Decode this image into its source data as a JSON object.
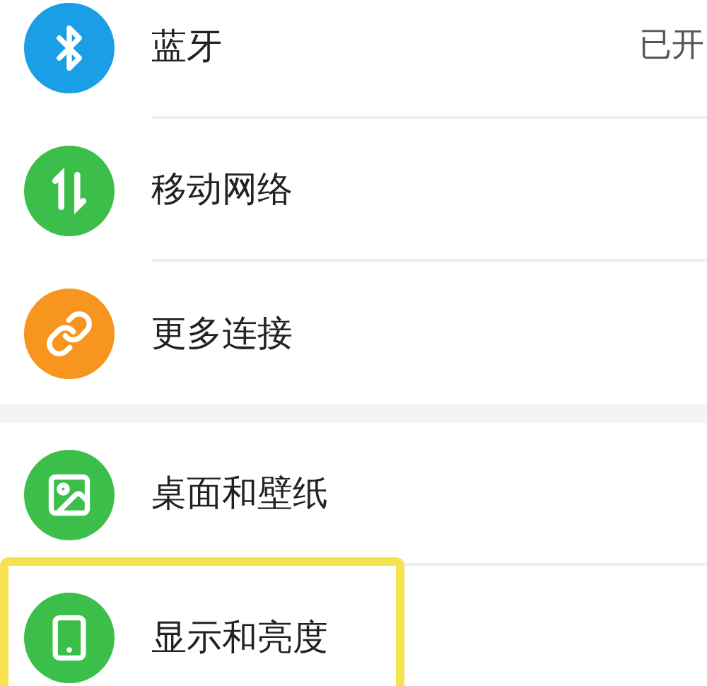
{
  "sections": [
    {
      "items": [
        {
          "kind": "bluetooth",
          "label": "蓝牙",
          "color": "#1a9fe6",
          "value": "已开",
          "highlighted": false
        },
        {
          "kind": "network",
          "label": "移动网络",
          "color": "#3cbf4a",
          "highlighted": false
        },
        {
          "kind": "link",
          "label": "更多连接",
          "color": "#f7951e",
          "highlighted": false
        }
      ]
    },
    {
      "items": [
        {
          "kind": "wallpaper",
          "label": "桌面和壁纸",
          "color": "#3cbf4a",
          "highlighted": false
        },
        {
          "kind": "display",
          "label": "显示和亮度",
          "color": "#3cbf4a",
          "highlighted": true
        }
      ]
    }
  ]
}
